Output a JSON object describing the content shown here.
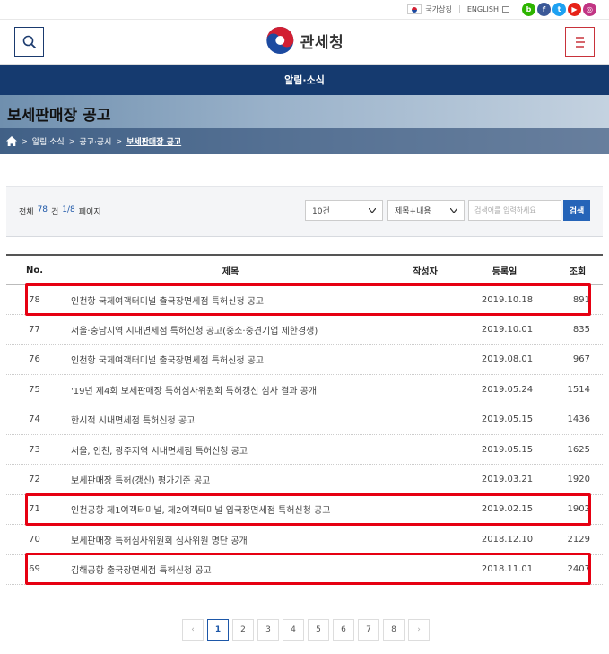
{
  "utility": {
    "national_symbols": "국가상징",
    "english": "ENGLISH",
    "socials": [
      {
        "name": "blog",
        "glyph": "b",
        "color": "#2db400"
      },
      {
        "name": "facebook",
        "glyph": "f",
        "color": "#3b5998"
      },
      {
        "name": "twitter",
        "glyph": "t",
        "color": "#1da1f2"
      },
      {
        "name": "youtube",
        "glyph": "▶",
        "color": "#e62117"
      },
      {
        "name": "instagram",
        "glyph": "◎",
        "color": "#c13584"
      }
    ]
  },
  "header": {
    "logo_text": "관세청"
  },
  "nav": {
    "section": "알림·소식"
  },
  "page": {
    "title": "보세판매장 공고",
    "breadcrumb": [
      "알림·소식",
      "공고·공시",
      "보세판매장 공고"
    ]
  },
  "search": {
    "total_label": "전체",
    "total_count": "78",
    "count_unit": "건",
    "page_info": "1/8",
    "page_label": "페이지",
    "per_page": "10건",
    "field": "제목+내용",
    "placeholder": "검색어를 입력하세요",
    "button": "검색"
  },
  "table": {
    "headers": {
      "no": "No.",
      "title": "제목",
      "author": "작성자",
      "date": "등록일",
      "views": "조회"
    },
    "rows": [
      {
        "no": "78",
        "title": "인천항 국제여객터미널 출국장면세점 특허신청 공고",
        "author": "",
        "date": "2019.10.18",
        "views": "891"
      },
      {
        "no": "77",
        "title": "서울·충남지역 시내면세점 특허신청 공고(중소·중견기업 제한경쟁)",
        "author": "",
        "date": "2019.10.01",
        "views": "835"
      },
      {
        "no": "76",
        "title": "인천항 국제여객터미널 출국장면세점 특허신청 공고",
        "author": "",
        "date": "2019.08.01",
        "views": "967"
      },
      {
        "no": "75",
        "title": "'19년 제4회 보세판매장 특허심사위원회 특허갱신 심사 결과 공개",
        "author": "",
        "date": "2019.05.24",
        "views": "1514"
      },
      {
        "no": "74",
        "title": "한시적 시내면세점 특허신청 공고",
        "author": "",
        "date": "2019.05.15",
        "views": "1436"
      },
      {
        "no": "73",
        "title": "서울, 인천, 광주지역 시내면세점 특허신청 공고",
        "author": "",
        "date": "2019.05.15",
        "views": "1625"
      },
      {
        "no": "72",
        "title": "보세판매장 특허(갱신) 평가기준 공고",
        "author": "",
        "date": "2019.03.21",
        "views": "1920"
      },
      {
        "no": "71",
        "title": "인천공항 제1여객터미널, 제2여객터미널 입국장면세점 특허신청 공고",
        "author": "",
        "date": "2019.02.15",
        "views": "1902"
      },
      {
        "no": "70",
        "title": "보세판매장 특허심사위원회 심사위원 명단 공개",
        "author": "",
        "date": "2018.12.10",
        "views": "2129"
      },
      {
        "no": "69",
        "title": "김해공항 출국장면세점 특허신청 공고",
        "author": "",
        "date": "2018.11.01",
        "views": "2407"
      }
    ]
  },
  "pagination": {
    "prev": "‹",
    "next": "›",
    "pages": [
      "1",
      "2",
      "3",
      "4",
      "5",
      "6",
      "7",
      "8"
    ],
    "current": "1"
  },
  "colors": {
    "nav": "#153a6f",
    "accent": "#1d57a8",
    "highlight": "#e60012"
  }
}
